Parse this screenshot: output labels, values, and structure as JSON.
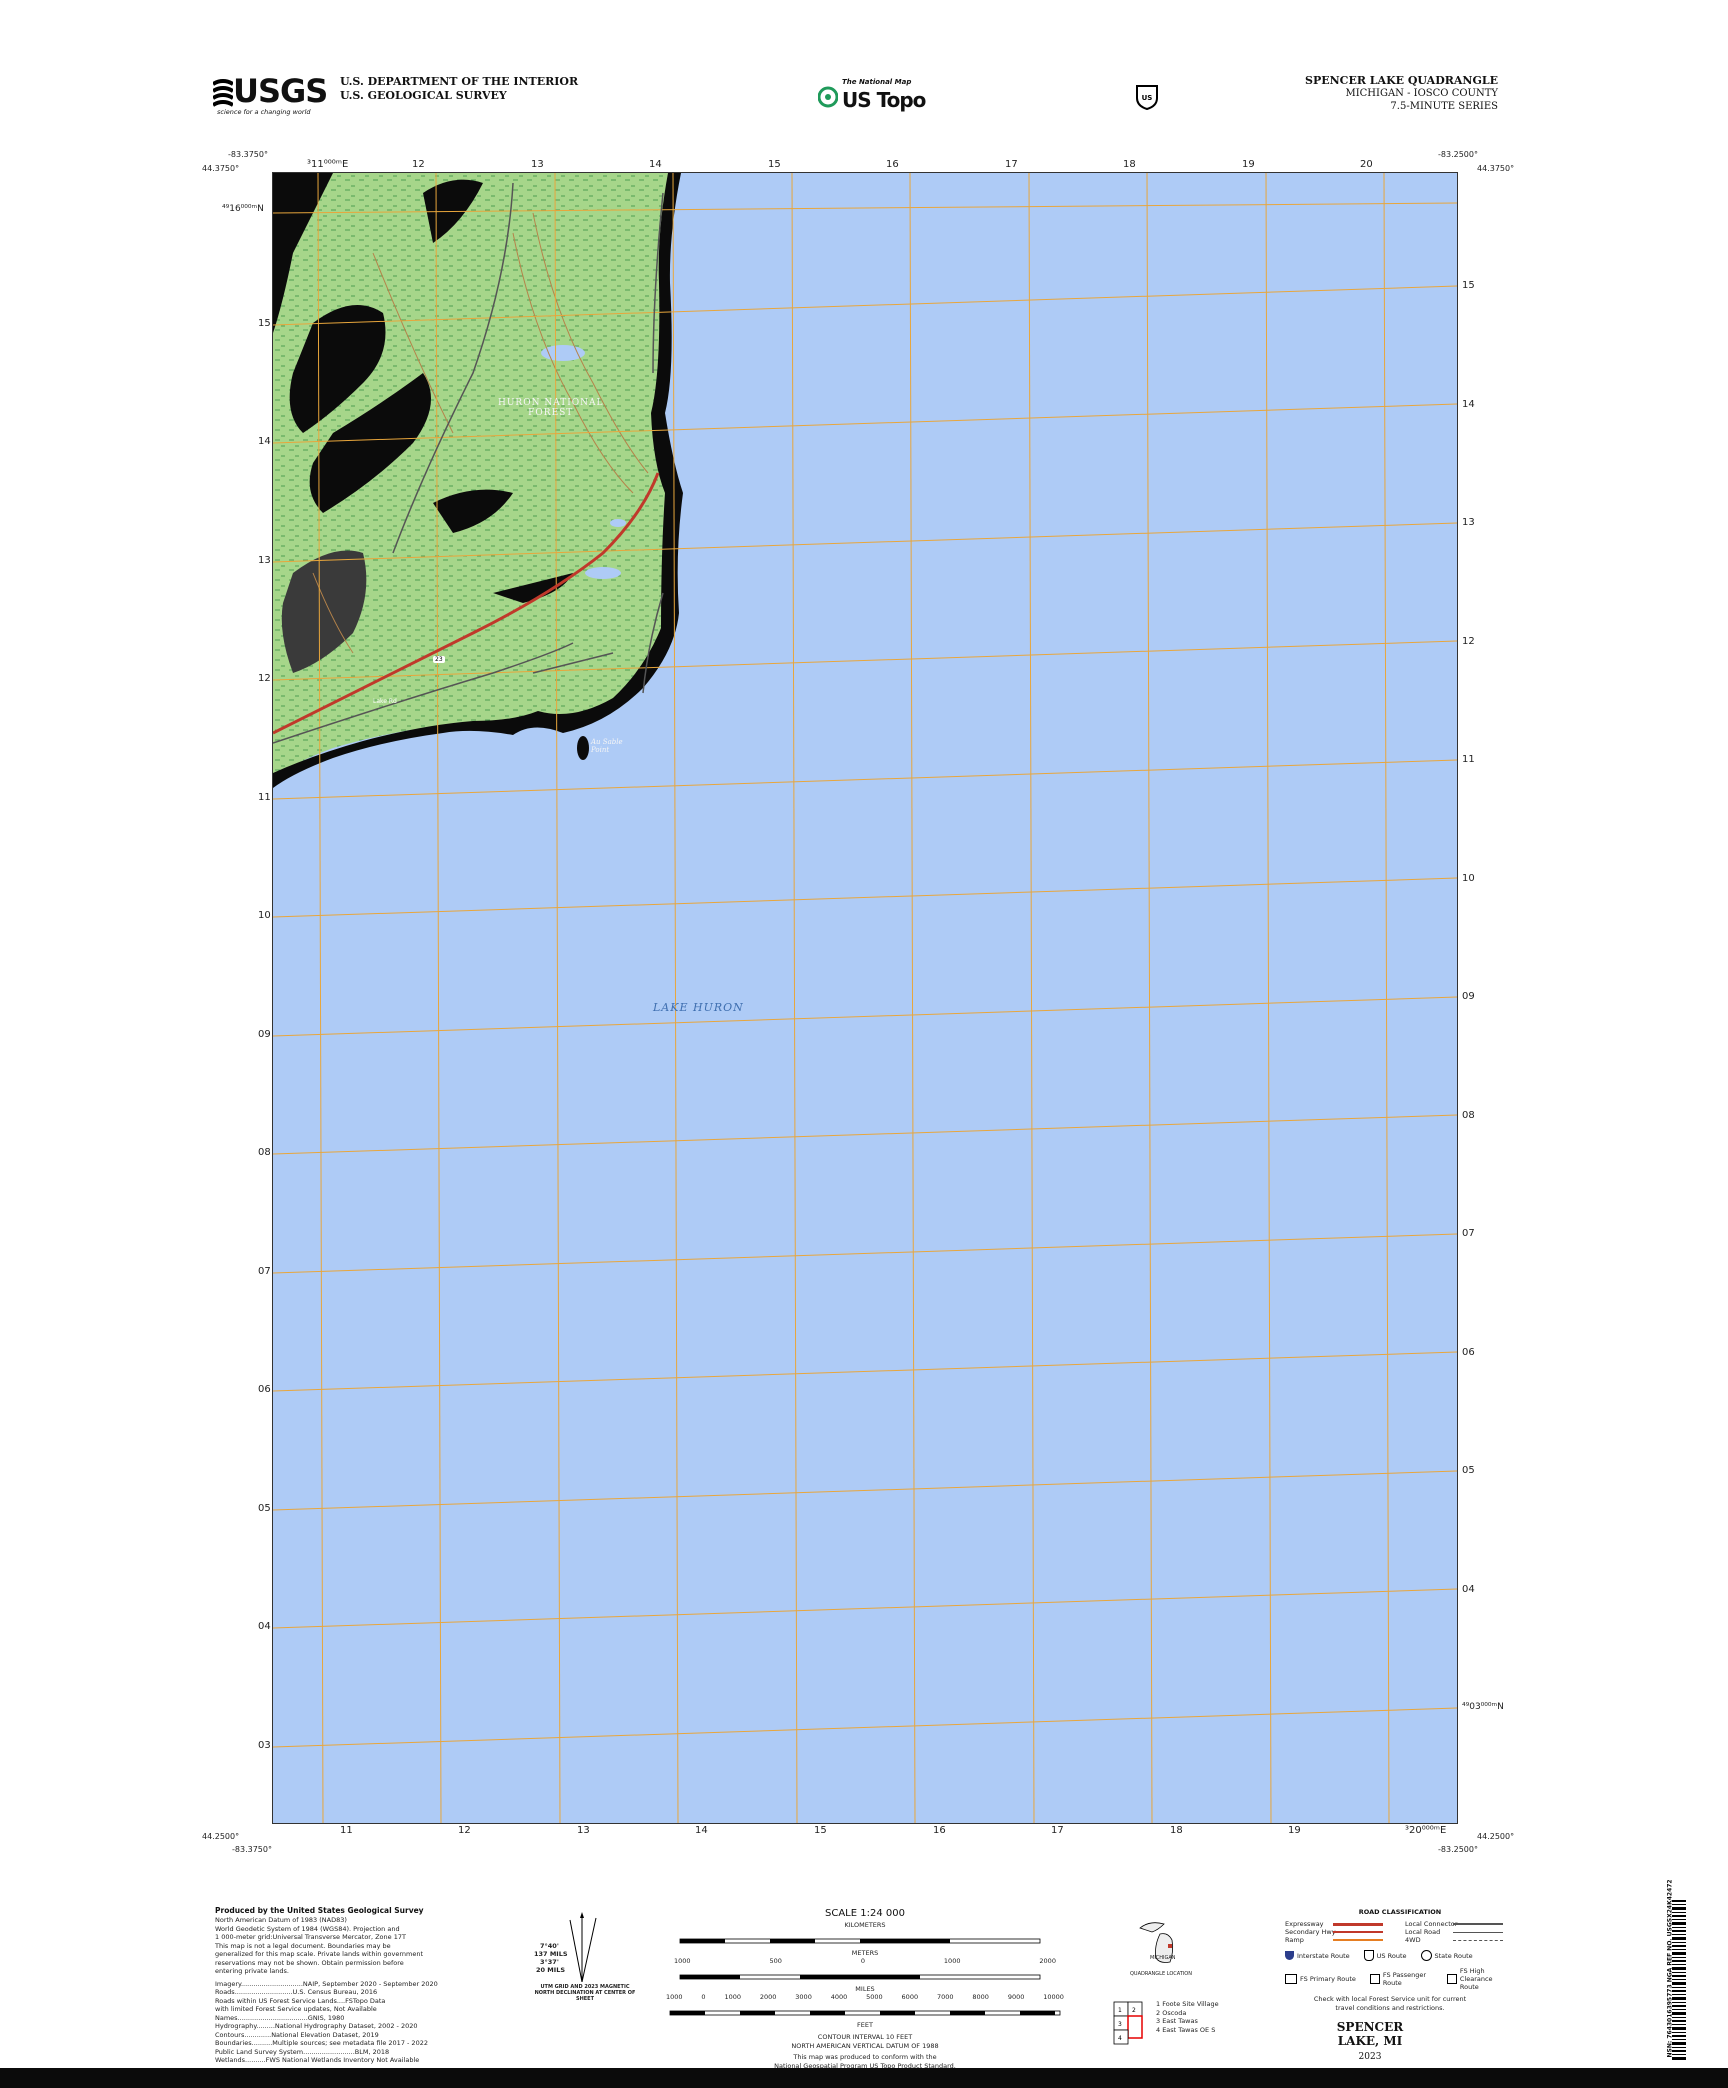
{
  "header": {
    "agency_line1": "U.S. DEPARTMENT OF THE INTERIOR",
    "agency_line2": "U.S. GEOLOGICAL SURVEY",
    "usgs_logo_text": "USGS",
    "usgs_tagline": "science for a changing world",
    "national_map_small": "The National Map",
    "us_topo": "US Topo",
    "quad_title": "SPENCER LAKE QUADRANGLE",
    "state_county": "MICHIGAN - IOSCO COUNTY",
    "series": "7.5-MINUTE SERIES"
  },
  "corners": {
    "nw_lat": "44.3750°",
    "nw_lon": "-83.3750°",
    "ne_lat": "44.3750°",
    "ne_lon": "-83.2500°",
    "sw_lat": "44.2500°",
    "sw_lon": "-83.3750°",
    "se_lat": "44.2500°",
    "se_lon": "-83.2500°"
  },
  "grid_labels": {
    "top": [
      "311000mE",
      "12",
      "13",
      "14",
      "15",
      "16",
      "17",
      "18",
      "19",
      "20"
    ],
    "top_first_label": "³11⁰⁰⁰ᵐE",
    "bottom": [
      "11",
      "12",
      "13",
      "14",
      "15",
      "16",
      "17",
      "18",
      "19",
      "³20⁰⁰⁰ᵐE"
    ],
    "left": [
      "⁴⁹16⁰⁰⁰ᵐN",
      "15",
      "14",
      "13",
      "12",
      "11",
      "10",
      "09",
      "08",
      "07",
      "06",
      "05",
      "04",
      "03"
    ],
    "right": [
      "15",
      "14",
      "13",
      "12",
      "11",
      "10",
      "09",
      "08",
      "07",
      "06",
      "05",
      "04",
      "⁴⁹03⁰⁰⁰ᵐN"
    ]
  },
  "map_labels": {
    "forest": "HURON NATIONAL",
    "forest2": "FOREST",
    "lake": "LAKE HURON",
    "point": "Au Sable",
    "point2": "Point",
    "lake_road": "Lake Rd",
    "road_23": "23"
  },
  "footer": {
    "produced_by": "Produced by the United States Geological Survey",
    "credits": [
      "North American Datum of 1983 (NAD83)",
      "World Geodetic System of 1984 (WGS84). Projection and",
      "1 000-meter grid:Universal Transverse Mercator, Zone 17T",
      "This map is not a legal document. Boundaries may be",
      "generalized for this map scale. Private lands within government",
      "reservations may not be shown. Obtain permission before",
      "entering private lands."
    ],
    "sources": [
      "Imagery..............................NAIP, September 2020 - September 2020",
      "Roads............................U.S. Census Bureau, 2016",
      "Roads within US Forest Service Lands....FSTopo Data",
      "with limited Forest Service updates, Not Available",
      "Names..................................GNIS, 1980",
      "Hydrography.........National Hydrography Dataset, 2002 - 2020",
      "Contours.............National Elevation Dataset, 2019",
      "Boundaries..........Multiple sources; see metadata file 2017 - 2022",
      "Public Land Survey System.........................BLM, 2018",
      "Wetlands..........FWS National Wetlands Inventory Not Available"
    ],
    "scale": "SCALE 1:24 000",
    "kilometers": "KILOMETERS",
    "meters": "METERS",
    "miles": "MILES",
    "feet": "FEET",
    "km_ticks": [
      "1",
      "0.5",
      "0",
      "1",
      "2"
    ],
    "m_ticks": [
      "1000",
      "500",
      "0",
      "1000",
      "2000"
    ],
    "mi_ticks": [
      "1",
      "0.5",
      "0",
      "1"
    ],
    "ft_ticks": [
      "1000",
      "0",
      "1000",
      "2000",
      "3000",
      "4000",
      "5000",
      "6000",
      "7000",
      "8000",
      "9000",
      "10000"
    ],
    "contour": "CONTOUR INTERVAL 10 FEET",
    "datum": "NORTH AMERICAN VERTICAL DATUM OF 1988",
    "standard1": "This map was produced to conform with the",
    "standard2": "National Geospatial Program US Topo Product Standard.",
    "declination": "UTM GRID AND 2023 MAGNETIC NORTH DECLINATION AT CENTER OF SHEET",
    "decl_values": [
      "7°40'",
      "137 MILS",
      "3°37'",
      "20 MILS"
    ],
    "quad_location": "QUADRANGLE LOCATION",
    "state_label": "MICHIGAN",
    "adjoining": [
      "1 Foote Site Village",
      "2 Oscoda",
      "3 East Tawas",
      "4 East Tawas OE S"
    ],
    "road_class_title": "ROAD CLASSIFICATION",
    "road_left": [
      "Expressway",
      "Secondary Hwy",
      "Ramp"
    ],
    "road_right": [
      "Local Connector",
      "Local Road",
      "4WD"
    ],
    "shields": [
      "Interstate Route",
      "US Route",
      "State Route"
    ],
    "fs_routes": [
      "FS Primary Route",
      "FS Passenger Route",
      "FS High Clearance Route"
    ],
    "fs_note": "Check with local Forest Service unit for current travel conditions and restrictions.",
    "map_name": "SPENCER LAKE, MI",
    "year": "2023",
    "barcode_text": "NSN: 7643016395773 NGA REF NO. USGSX24K42472"
  },
  "colors": {
    "water": "#aecbf6",
    "land": "#a6d68a",
    "wetland": "#000000",
    "grid": "#e8a63c",
    "road": "#c0392b"
  }
}
